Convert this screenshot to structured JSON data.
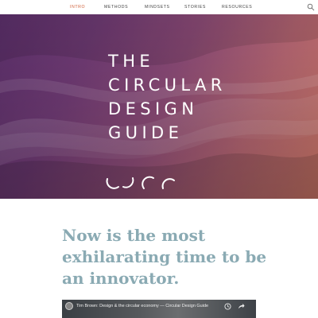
{
  "nav": {
    "items": [
      {
        "label": "INTRO",
        "active": true
      },
      {
        "label": "METHODS",
        "active": false
      },
      {
        "label": "MINDSETS",
        "active": false
      },
      {
        "label": "STORIES",
        "active": false
      },
      {
        "label": "RESOURCES",
        "active": false
      }
    ],
    "active_color": "#d0603a",
    "search_icon": "search-icon"
  },
  "hero": {
    "title_lines": [
      "THE",
      "CIRCULAR",
      "DESIGN",
      "GUIDE"
    ],
    "gradient_colors": [
      "#5b2f6a",
      "#8a4a75",
      "#c97566"
    ],
    "logo": "circular-arcs-logo"
  },
  "main": {
    "headline": "Now is the most exhilarating time to be an innovator.",
    "headline_color": "#8aaab3"
  },
  "video": {
    "title": "Tim Brown: Design & the circular economy — Circular Design Guide",
    "icons": [
      "clock-icon",
      "share-icon"
    ]
  }
}
